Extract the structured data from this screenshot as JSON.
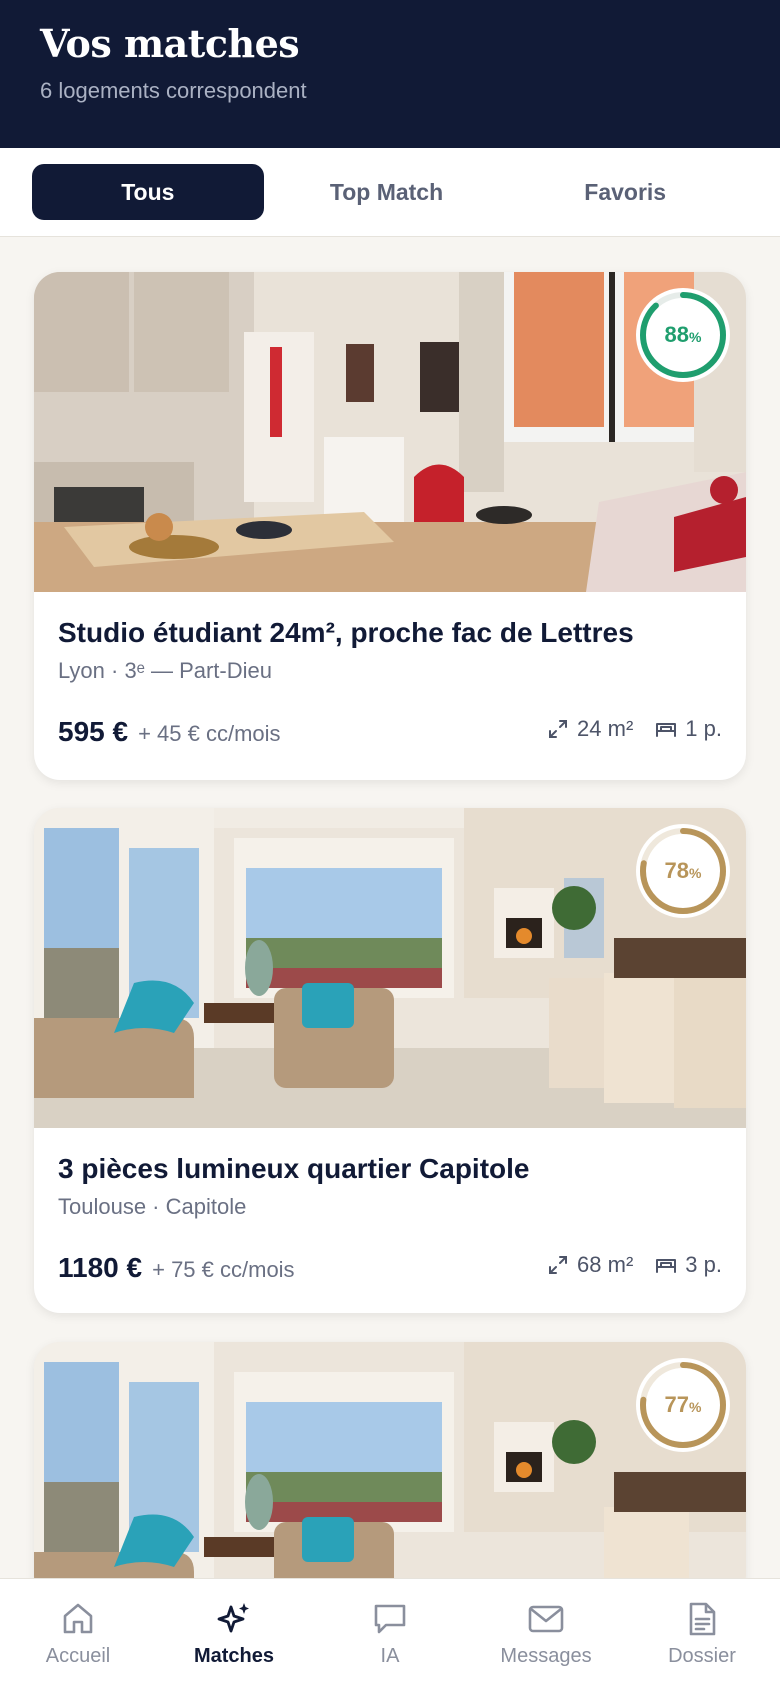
{
  "header": {
    "title": "Vos matches",
    "subtitle": "6 logements correspondent"
  },
  "tabs": [
    {
      "label": "Tous",
      "active": true
    },
    {
      "label": "Top Match",
      "active": false
    },
    {
      "label": "Favoris",
      "active": false
    }
  ],
  "listings": [
    {
      "match": "88",
      "match_unit": "%",
      "match_value": 0.88,
      "match_color": "#1f9e6e",
      "title": "Studio étudiant 24m², proche fac de Lettres",
      "location": "Lyon · 3ᵉ — Part-Dieu",
      "price": "595 €",
      "price_extra": "+ 45 € cc/mois",
      "area": "24 m²",
      "rooms": "1 p."
    },
    {
      "match": "78",
      "match_unit": "%",
      "match_value": 0.78,
      "match_color": "#b8955a",
      "title": "3 pièces lumineux quartier Capitole",
      "location": "Toulouse · Capitole",
      "price": "1180 €",
      "price_extra": "+ 75 € cc/mois",
      "area": "68 m²",
      "rooms": "3 p."
    },
    {
      "match": "77",
      "match_unit": "%",
      "match_value": 0.77,
      "match_color": "#b8955a"
    }
  ],
  "nav": [
    {
      "label": "Accueil",
      "icon": "home-icon",
      "active": false
    },
    {
      "label": "Matches",
      "icon": "sparkles-icon",
      "active": true
    },
    {
      "label": "IA",
      "icon": "chat-bubble-icon",
      "active": false
    },
    {
      "label": "Messages",
      "icon": "envelope-icon",
      "active": false
    },
    {
      "label": "Dossier",
      "icon": "document-icon",
      "active": false
    }
  ]
}
